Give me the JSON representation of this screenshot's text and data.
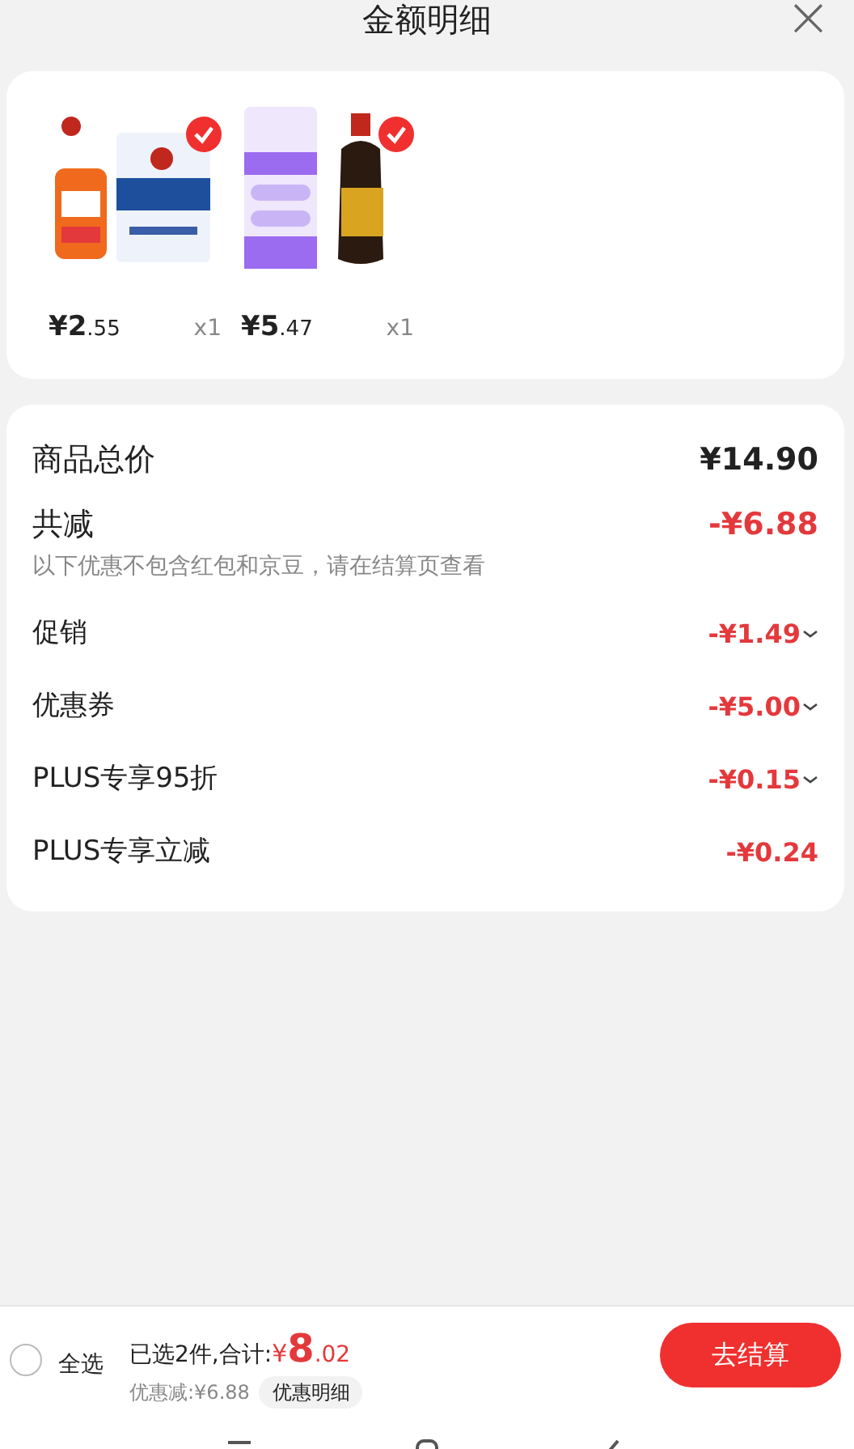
{
  "header": {
    "title": "金额明细",
    "close": "×"
  },
  "products": [
    {
      "price_main": "¥2",
      "price_decimal": ".55",
      "quantity": "x1",
      "selected": true
    },
    {
      "price_main": "¥5",
      "price_decimal": ".47",
      "quantity": "x1",
      "selected": true
    }
  ],
  "summary": {
    "total_label": "商品总价",
    "total_value": "¥14.90",
    "discount_label": "共减",
    "discount_value": "-¥6.88",
    "note": "以下优惠不包含红包和京豆，请在结算页查看"
  },
  "discounts": [
    {
      "label": "促销",
      "value": "-¥1.49",
      "expandable": true
    },
    {
      "label": "优惠券",
      "value": "-¥5.00",
      "expandable": true
    },
    {
      "label": "PLUS专享95折",
      "value": "-¥0.15",
      "expandable": true
    },
    {
      "label": "PLUS专享立减",
      "value": "-¥0.24",
      "expandable": false
    }
  ],
  "footer": {
    "select_all": "全选",
    "select_all_checked": false,
    "total_prefix": "已选2件,合计:",
    "total_currency": "¥",
    "total_integer": "8",
    "total_decimal": ".02",
    "saved": "优惠减:¥6.88",
    "detail_button": "优惠明细",
    "checkout": "去结算"
  }
}
